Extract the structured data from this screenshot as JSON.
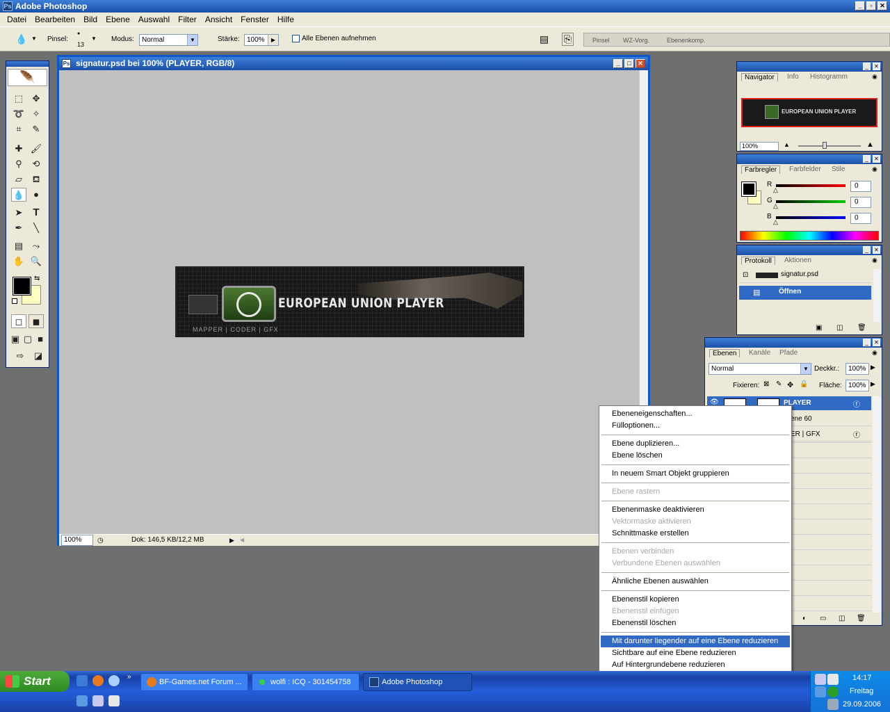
{
  "app": {
    "title": "Adobe Photoshop"
  },
  "menubar": [
    "Datei",
    "Bearbeiten",
    "Bild",
    "Ebene",
    "Auswahl",
    "Filter",
    "Ansicht",
    "Fenster",
    "Hilfe"
  ],
  "options": {
    "brush_label": "Pinsel:",
    "brush_size": "13",
    "mode_label": "Modus:",
    "mode_value": "Normal",
    "strength_label": "Stärke:",
    "strength_value": "100%",
    "all_layers_label": "Alle Ebenen aufnehmen",
    "well_tabs": [
      "Pinsel",
      "WZ-Vorg.",
      "Ebenenkomp."
    ]
  },
  "document": {
    "title": "signatur.psd bei 100% (PLAYER, RGB/8)",
    "zoom": "100%",
    "doc_info": "Dok: 146,5 KB/12,2 MB",
    "banner_title": "EUROPEAN UNION PLAYER",
    "banner_sub": "MAPPER  |  CODER  |  GFX"
  },
  "navigator": {
    "tabs": [
      "Navigator",
      "Info",
      "Histogramm"
    ],
    "zoom": "100%",
    "thumb_title": "EUROPEAN UNION PLAYER"
  },
  "color": {
    "tabs": [
      "Farbregler",
      "Farbfelder",
      "Stile"
    ],
    "r_label": "R",
    "g_label": "G",
    "b_label": "B",
    "r": "0",
    "g": "0",
    "b": "0",
    "fg": "#000000",
    "bg": "#ffffc0"
  },
  "history": {
    "tabs": [
      "Protokoll",
      "Aktionen"
    ],
    "snapshot": "signatur.psd",
    "step": "Öffnen"
  },
  "layers": {
    "tabs": [
      "Ebenen",
      "Kanäle",
      "Pfade"
    ],
    "blend": "Normal",
    "opacity_label": "Deckkr.:",
    "opacity": "100%",
    "lock_label": "Fixieren:",
    "fill_label": "Fläche:",
    "fill": "100%",
    "rows": [
      "PLAYER",
      "ene 60",
      "ER | GFX"
    ]
  },
  "context_menu": {
    "groups": [
      [
        {
          "label": "Ebeneneigenschaften...",
          "disabled": false
        },
        {
          "label": "Fülloptionen...",
          "disabled": false
        }
      ],
      [
        {
          "label": "Ebene duplizieren...",
          "disabled": false
        },
        {
          "label": "Ebene löschen",
          "disabled": false
        }
      ],
      [
        {
          "label": "In neuem Smart Objekt gruppieren",
          "disabled": false
        }
      ],
      [
        {
          "label": "Ebene rastern",
          "disabled": true
        }
      ],
      [
        {
          "label": "Ebenenmaske deaktivieren",
          "disabled": false
        },
        {
          "label": "Vektormaske aktivieren",
          "disabled": true
        },
        {
          "label": "Schnittmaske erstellen",
          "disabled": false
        }
      ],
      [
        {
          "label": "Ebenen verbinden",
          "disabled": true
        },
        {
          "label": "Verbundene Ebenen auswählen",
          "disabled": true
        }
      ],
      [
        {
          "label": "Ähnliche Ebenen auswählen",
          "disabled": false
        }
      ],
      [
        {
          "label": "Ebenenstil kopieren",
          "disabled": false
        },
        {
          "label": "Ebenenstil einfügen",
          "disabled": true
        },
        {
          "label": "Ebenenstil löschen",
          "disabled": false
        }
      ],
      [
        {
          "label": "Mit darunter liegender auf eine Ebene reduzieren",
          "disabled": false,
          "selected": true
        },
        {
          "label": "Sichtbare auf eine Ebene reduzieren",
          "disabled": false
        },
        {
          "label": "Auf Hintergrundebene reduzieren",
          "disabled": false
        }
      ]
    ]
  },
  "taskbar": {
    "start": "Start",
    "buttons": [
      "BF-Games.net Forum ...",
      "wolfi : ICQ - 301454758",
      "Adobe Photoshop"
    ],
    "time": "14:17",
    "day": "Freitag",
    "date": "29.09.2006"
  }
}
